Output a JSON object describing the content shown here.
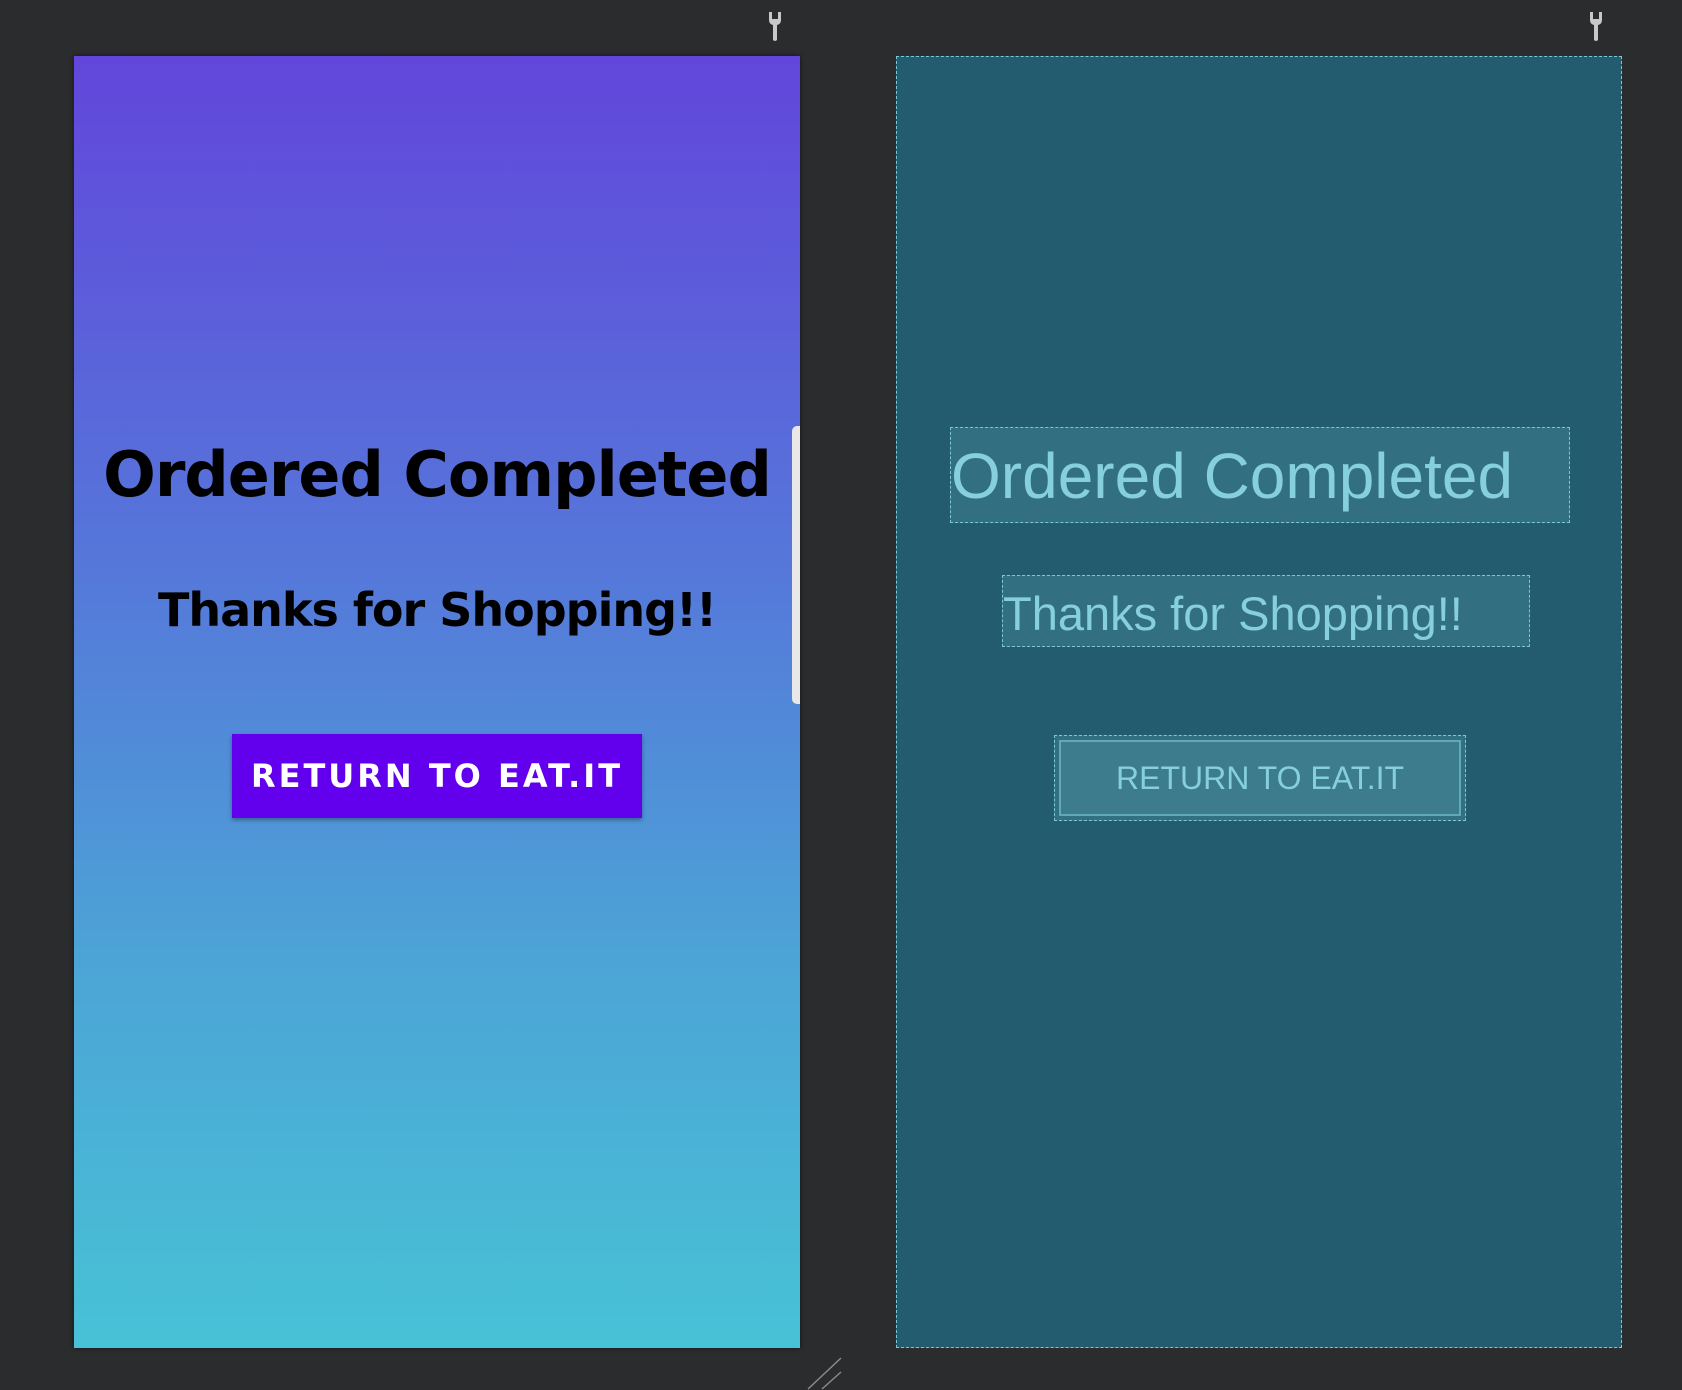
{
  "design_preview": {
    "title": "Ordered Completed",
    "subtitle": "Thanks for Shopping!!",
    "button_label": "RETURN TO EAT.IT"
  },
  "blueprint_preview": {
    "title": "Ordered Completed",
    "subtitle": "Thanks for Shopping!!",
    "button_label": "RETURN TO EAT.IT"
  },
  "icons": {
    "pin_left": "pin-icon",
    "pin_right": "pin-icon",
    "resize": "resize-handle-icon"
  },
  "colors": {
    "canvas_background": "#2b2c2e",
    "gradient_top": "#6246db",
    "gradient_bottom": "#48c2d6",
    "button_primary": "#6200ee",
    "blueprint_background": "#235c6e",
    "blueprint_outline": "#7cc6d6"
  }
}
